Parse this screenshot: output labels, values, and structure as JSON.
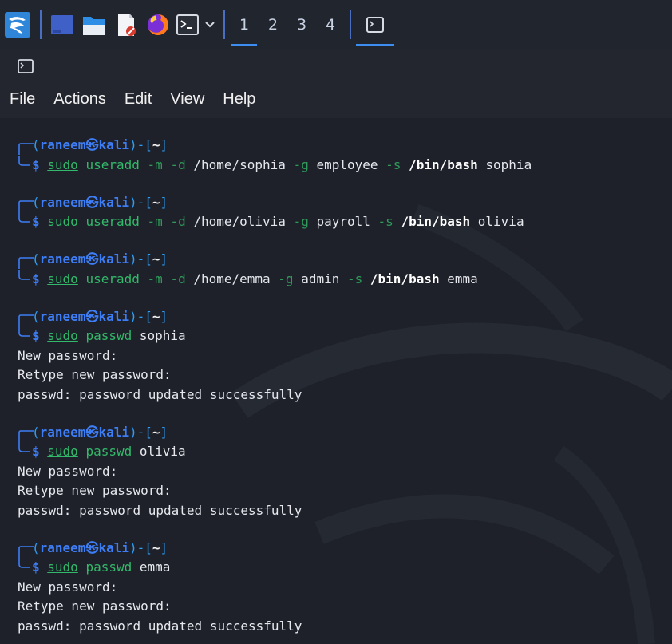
{
  "taskbar": {
    "workspaces": [
      "1",
      "2",
      "3",
      "4"
    ],
    "active_workspace": "1"
  },
  "menu": [
    "File",
    "Actions",
    "Edit",
    "View",
    "Help"
  ],
  "prompt": {
    "user": "raneem",
    "at": "㉿",
    "host": "kali",
    "dir": "~",
    "dollar": "$"
  },
  "terminal": {
    "blocks": [
      {
        "cmd": [
          {
            "t": "sudo",
            "c": "c-sudo"
          },
          {
            "t": " "
          },
          {
            "t": "useradd",
            "c": "c-cmd"
          },
          {
            "t": " "
          },
          {
            "t": "-m",
            "c": "c-opt"
          },
          {
            "t": " "
          },
          {
            "t": "-d",
            "c": "c-opt"
          },
          {
            "t": " /home/sophia ",
            "c": "c-arg"
          },
          {
            "t": "-g",
            "c": "c-opt"
          },
          {
            "t": " employee ",
            "c": "c-arg"
          },
          {
            "t": "-s",
            "c": "c-opt"
          },
          {
            "t": " "
          },
          {
            "t": "/bin/bash",
            "c": "c-bold"
          },
          {
            "t": " sophia",
            "c": "c-arg"
          }
        ],
        "output": []
      },
      {
        "cmd": [
          {
            "t": "sudo",
            "c": "c-sudo"
          },
          {
            "t": " "
          },
          {
            "t": "useradd",
            "c": "c-cmd"
          },
          {
            "t": " "
          },
          {
            "t": "-m",
            "c": "c-opt"
          },
          {
            "t": " "
          },
          {
            "t": "-d",
            "c": "c-opt"
          },
          {
            "t": " /home/olivia ",
            "c": "c-arg"
          },
          {
            "t": "-g",
            "c": "c-opt"
          },
          {
            "t": " payroll ",
            "c": "c-arg"
          },
          {
            "t": "-s",
            "c": "c-opt"
          },
          {
            "t": " "
          },
          {
            "t": "/bin/bash",
            "c": "c-bold"
          },
          {
            "t": " olivia",
            "c": "c-arg"
          }
        ],
        "output": []
      },
      {
        "cmd": [
          {
            "t": "sudo",
            "c": "c-sudo"
          },
          {
            "t": " "
          },
          {
            "t": "useradd",
            "c": "c-cmd"
          },
          {
            "t": " "
          },
          {
            "t": "-m",
            "c": "c-opt"
          },
          {
            "t": " "
          },
          {
            "t": "-d",
            "c": "c-opt"
          },
          {
            "t": " /home/emma ",
            "c": "c-arg"
          },
          {
            "t": "-g",
            "c": "c-opt"
          },
          {
            "t": " admin ",
            "c": "c-arg"
          },
          {
            "t": "-s",
            "c": "c-opt"
          },
          {
            "t": " "
          },
          {
            "t": "/bin/bash",
            "c": "c-bold"
          },
          {
            "t": " emma",
            "c": "c-arg"
          }
        ],
        "output": []
      },
      {
        "cmd": [
          {
            "t": "sudo",
            "c": "c-sudo"
          },
          {
            "t": " "
          },
          {
            "t": "passwd",
            "c": "c-cmd"
          },
          {
            "t": " sophia",
            "c": "c-arg"
          }
        ],
        "output": [
          "New password:",
          "Retype new password:",
          "passwd: password updated successfully"
        ]
      },
      {
        "cmd": [
          {
            "t": "sudo",
            "c": "c-sudo"
          },
          {
            "t": " "
          },
          {
            "t": "passwd",
            "c": "c-cmd"
          },
          {
            "t": " olivia",
            "c": "c-arg"
          }
        ],
        "output": [
          "New password:",
          "Retype new password:",
          "passwd: password updated successfully"
        ]
      },
      {
        "cmd": [
          {
            "t": "sudo",
            "c": "c-sudo"
          },
          {
            "t": " "
          },
          {
            "t": "passwd",
            "c": "c-cmd"
          },
          {
            "t": " emma",
            "c": "c-arg"
          }
        ],
        "output": [
          "New password:",
          "Retype new password:",
          "passwd: password updated successfully"
        ]
      }
    ]
  },
  "colors": {
    "prompt_blue": "#3d7df6",
    "command_green": "#32b96a",
    "accent_underline": "#3d8df0",
    "terminal_bg": "#1e2129"
  },
  "icons": [
    "kali-dragon-icon",
    "desktop-icon",
    "file-manager-icon",
    "text-editor-icon",
    "firefox-icon",
    "terminal-icon",
    "chevron-down-icon",
    "terminal-window-icon"
  ]
}
